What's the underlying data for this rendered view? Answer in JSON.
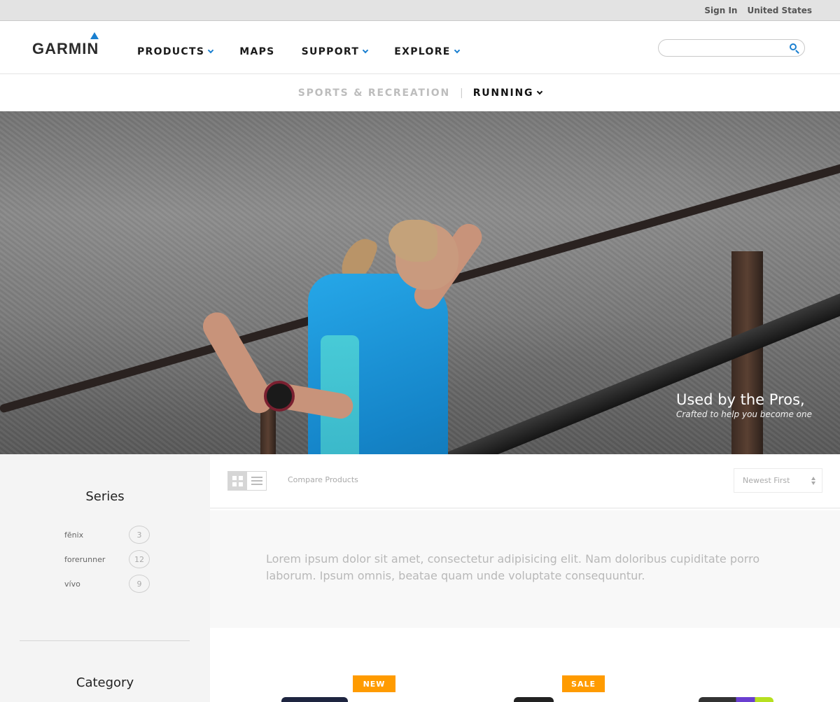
{
  "utility_bar": {
    "sign_in": "Sign In",
    "region": "United States"
  },
  "header": {
    "logo_text": "GARMIN",
    "search": {
      "placeholder": "",
      "value": ""
    },
    "nav": [
      {
        "label": "PRODUCTS",
        "has_dropdown": true
      },
      {
        "label": "MAPS",
        "has_dropdown": false
      },
      {
        "label": "SUPPORT",
        "has_dropdown": true
      },
      {
        "label": "EXPLORE",
        "has_dropdown": true
      }
    ]
  },
  "subnav": {
    "parent": "SPORTS & RECREATION",
    "separator": "|",
    "current": "RUNNING"
  },
  "hero": {
    "title": "Used by the Pros,",
    "subtitle": "Crafted to help you become one"
  },
  "sidebar": {
    "series_title": "Series",
    "series": [
      {
        "label": "fēnix",
        "count": "3"
      },
      {
        "label": "forerunner",
        "count": "12"
      },
      {
        "label": "vívo",
        "count": "9"
      }
    ],
    "category_title": "Category"
  },
  "toolbar": {
    "compare_label": "Compare Products",
    "sort_selected": "Newest First",
    "view_mode": "grid"
  },
  "intro_text": "Lorem ipsum dolor sit amet, consectetur adipisicing elit. Nam doloribus cupiditate porro laborum. Ipsum omnis, beatae quam unde voluptate consequuntur.",
  "products": [
    {
      "badge": "NEW"
    },
    {
      "badge": "SALE"
    },
    {
      "badge": ""
    }
  ],
  "colors": {
    "accent_blue": "#1a7fd0",
    "badge_orange": "#ff9b00"
  }
}
